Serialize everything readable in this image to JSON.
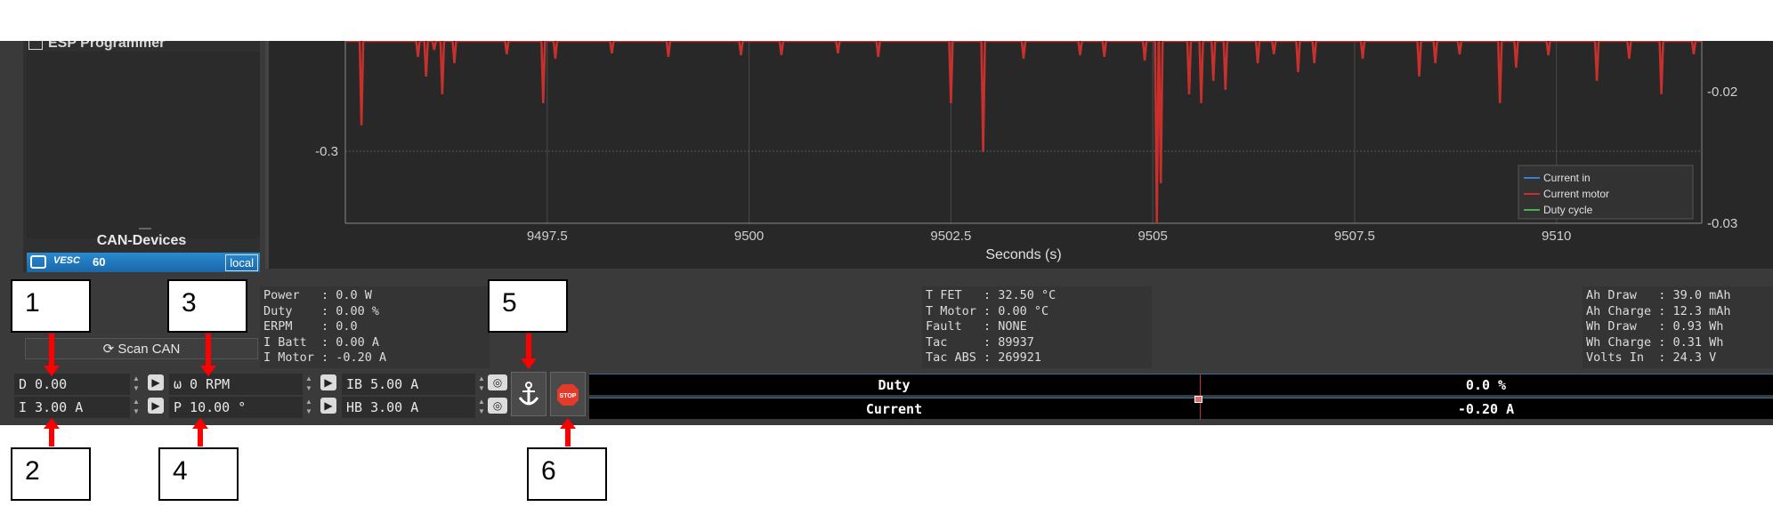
{
  "left_panel": {
    "title": "ESP Programmer",
    "can_title": "CAN-Devices",
    "device": {
      "brand": "VESC",
      "id": "60",
      "tag": "local"
    },
    "scan_button": "Scan CAN"
  },
  "plot": {
    "xlabel": "Seconds (s)",
    "x_ticks": [
      "9497.5",
      "9500",
      "9502.5",
      "9505",
      "9507.5",
      "9510"
    ],
    "left_tick": "-0.3",
    "right_ticks": [
      "-0.02",
      "-0.03"
    ],
    "legend": [
      {
        "name": "Current in",
        "color": "#3a7bd5"
      },
      {
        "name": "Current motor",
        "color": "#c8302c"
      },
      {
        "name": "Duty cycle",
        "color": "#4caf50"
      }
    ],
    "trace_color": "#c8302c"
  },
  "stats_left": "Power   : 0.0 W\nDuty    : 0.00 %\nERPM    : 0.0\nI Batt  : 0.00 A\nI Motor : -0.20 A",
  "stats_mid": "T FET   : 32.50 °C\nT Motor : 0.00 °C\nFault   : NONE\nTac     : 89937\nTac ABS : 269921",
  "stats_right": "Ah Draw   : 39.0 mAh\nAh Charge : 12.3 mAh\nWh Draw   : 0.93 Wh\nWh Charge : 0.31 Wh\nVolts In  : 24.3 V",
  "controls": {
    "duty": "D 0.00",
    "current": "I 3.00 A",
    "rpm": "ω 0 RPM",
    "position": "P 10.00 °",
    "ib": "IB 5.00 A",
    "hb": "HB 3.00 A"
  },
  "stop_label": "STOP",
  "bars": [
    {
      "label": "Duty",
      "value": "0.0 %"
    },
    {
      "label": "Current",
      "value": "-0.20 A"
    }
  ],
  "callouts": [
    "1",
    "2",
    "3",
    "4",
    "5",
    "6"
  ]
}
